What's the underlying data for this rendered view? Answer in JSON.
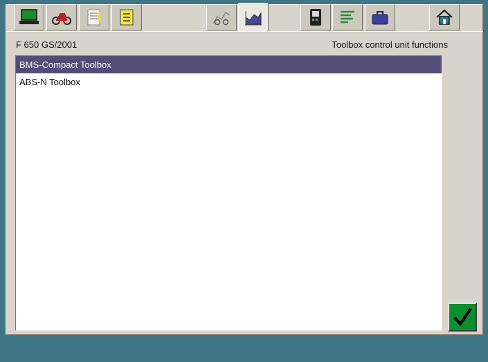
{
  "header": {
    "vehicle": "F 650 GS/2001",
    "title": "Toolbox control unit functions"
  },
  "tabs": [
    {
      "icon": "laptop-icon"
    },
    {
      "icon": "motorcycle-icon"
    },
    {
      "icon": "document-list-icon"
    },
    {
      "icon": "checklist-icon"
    },
    {
      "icon": "motorcycle-graph-icon"
    },
    {
      "icon": "chart-icon",
      "active": true
    },
    {
      "icon": "diagnostic-device-icon"
    },
    {
      "icon": "text-lines-icon"
    },
    {
      "icon": "toolbox-icon"
    },
    {
      "icon": "home-icon"
    }
  ],
  "list": {
    "items": [
      {
        "label": "BMS-Compact Toolbox",
        "selected": true
      },
      {
        "label": "ABS-N Toolbox",
        "selected": false
      }
    ]
  },
  "colors": {
    "background": "#3f7585",
    "panel": "#d8d4cc",
    "selection": "#544d78",
    "ok_button": "#0a8f2f"
  }
}
